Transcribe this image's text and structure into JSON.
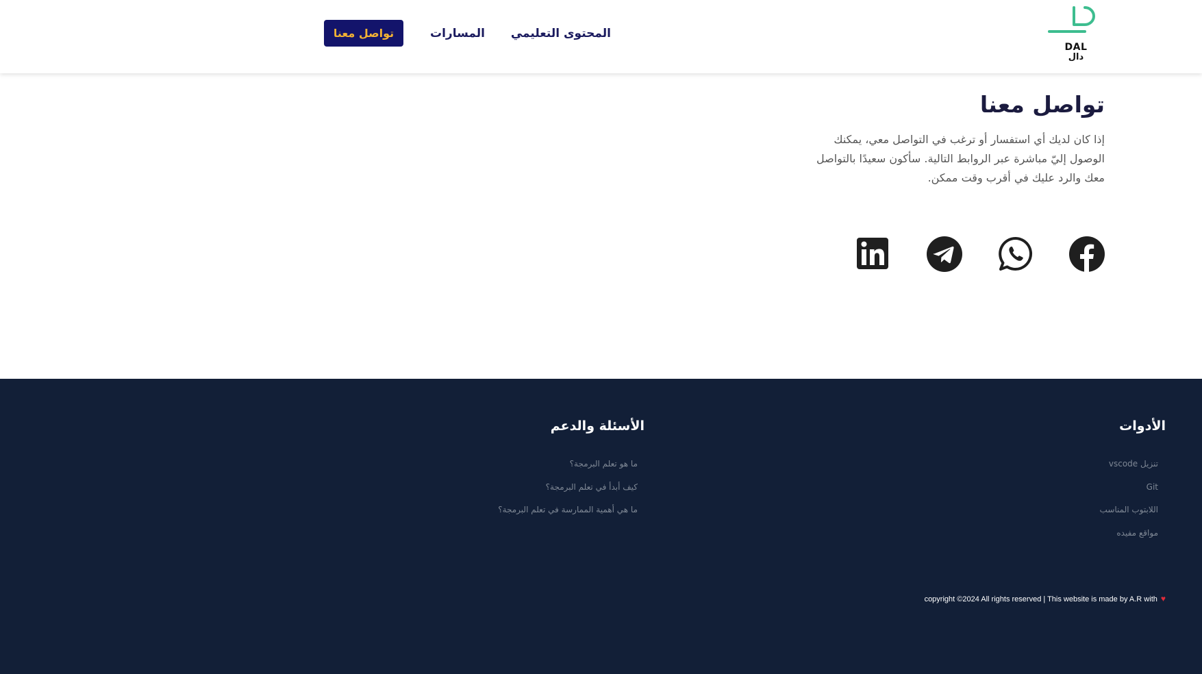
{
  "header": {
    "logo": {
      "text_en": "DAL",
      "text_ar": "دال",
      "accent_color": "#3dbd8f"
    },
    "nav": {
      "content_label": "المحتوى التعليمي",
      "paths_label": "المسارات",
      "contact_button_label": "تواصل معنا"
    },
    "button_bg_color": "#13146b",
    "button_text_color": "#f2b234"
  },
  "contact": {
    "title": "تواصل معنا",
    "description": "إذا كان لديك أي استفسار أو ترغب في التواصل معي، يمكنك الوصول إليّ مباشرة عبر الروابط التالية. سأكون سعيدًا بالتواصل معك والرد عليك في أقرب وقت ممكن.",
    "social": [
      {
        "icon": "facebook-icon"
      },
      {
        "icon": "whatsapp-icon"
      },
      {
        "icon": "telegram-icon"
      },
      {
        "icon": "linkedin-icon"
      }
    ]
  },
  "footer": {
    "bg_color": "#121f37",
    "tools": {
      "heading": "الأدوات",
      "items": [
        "تنزيل vscode",
        "Git",
        "اللابتوب المناسب",
        "مواقع مفيده"
      ]
    },
    "faq": {
      "heading": "الأسئلة والدعم",
      "items": [
        "ما هو تعلم البرمجة؟",
        "كيف أبدأ في تعلم البرمجة؟",
        "ما هي أهمية الممارسة في تعلم البرمجة؟"
      ]
    },
    "copyright": "copyright ©2024 All rights reserved | This website is made by A.R with",
    "heart_icon": "heart-icon"
  }
}
